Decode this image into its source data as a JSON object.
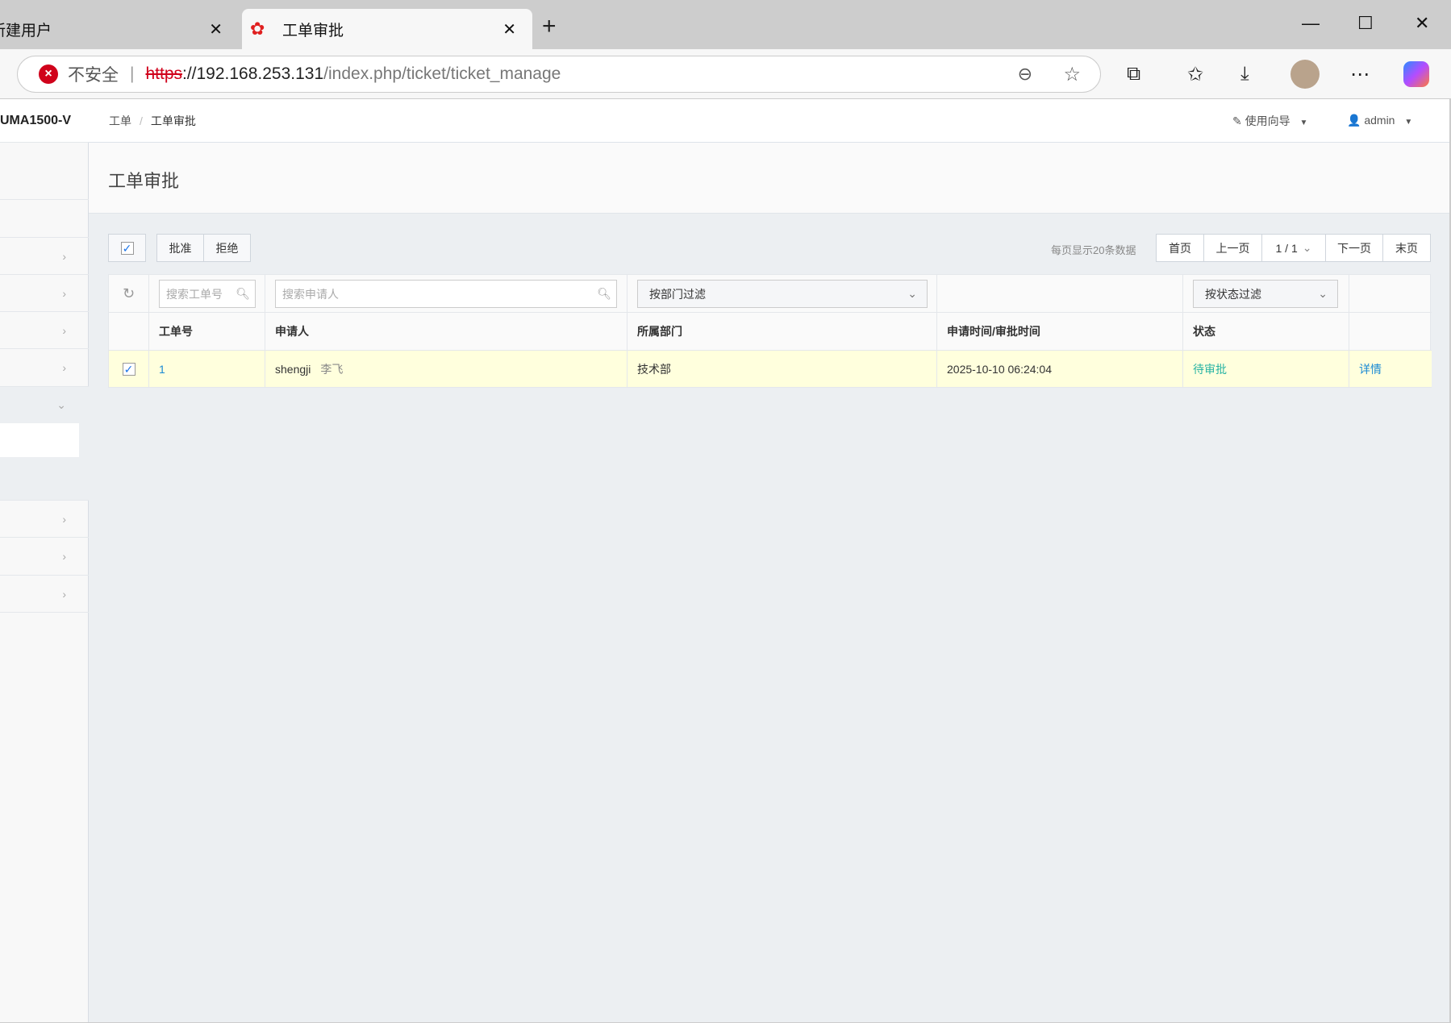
{
  "browser": {
    "tabs": [
      {
        "label": "新建用户"
      },
      {
        "label": "工单审批"
      }
    ],
    "security_label": "不安全",
    "url_scheme": "https",
    "url_host": "://192.168.253.131",
    "url_path": "/index.php/ticket/ticket_manage"
  },
  "app": {
    "brand": "UMA1500-V",
    "breadcrumb": [
      "工单",
      "工单审批"
    ],
    "guide_label": "使用向导",
    "user": "admin",
    "page_title": "工单审批"
  },
  "toolbar": {
    "approve": "批准",
    "reject": "拒绝",
    "per_page": "每页显示20条数据",
    "first": "首页",
    "prev": "上一页",
    "page": "1 / 1",
    "next": "下一页",
    "last": "末页"
  },
  "filters": {
    "ticket_placeholder": "搜索工单号",
    "applicant_placeholder": "搜索申请人",
    "dept": "按部门过滤",
    "status": "按状态过滤"
  },
  "table": {
    "headers": [
      "工单号",
      "申请人",
      "所属部门",
      "申请时间/审批时间",
      "状态"
    ],
    "rows": [
      {
        "id": "1",
        "user": "shengji",
        "name": "李飞",
        "dept": "技术部",
        "time": "2025-10-10 06:24:04",
        "status": "待审批",
        "action": "详情"
      }
    ]
  },
  "colors": {
    "link": "#1a8ad4",
    "status": "#27b3a3",
    "row_highlight": "#ffffdd"
  }
}
